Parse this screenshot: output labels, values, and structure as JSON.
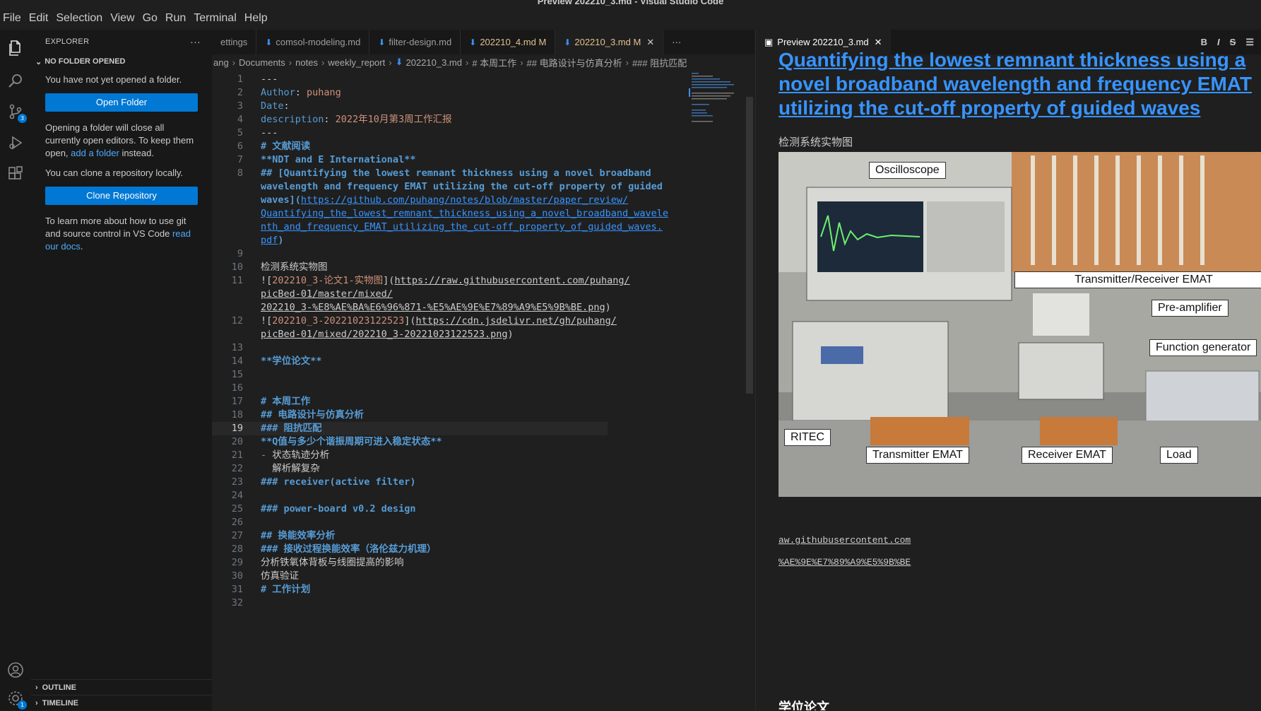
{
  "window": {
    "title": "Preview 202210_3.md - Visual Studio Code"
  },
  "menu": [
    "File",
    "Edit",
    "Selection",
    "View",
    "Go",
    "Run",
    "Terminal",
    "Help"
  ],
  "activity": {
    "scm_badge": "3",
    "settings_badge": "1"
  },
  "sidebar": {
    "title": "EXPLORER",
    "section": "NO FOLDER OPENED",
    "p1": "You have not yet opened a folder.",
    "open_folder": "Open Folder",
    "p2a": "Opening a folder will close all currently open editors. To keep them open, ",
    "p2link": "add a folder",
    "p2b": " instead.",
    "p3": "You can clone a repository locally.",
    "clone": "Clone Repository",
    "p4a": "To learn more about how to use git and source control in VS Code ",
    "p4link": "read our docs",
    "p4b": ".",
    "outline": "OUTLINE",
    "timeline": "TIMELINE"
  },
  "tabs": [
    {
      "label": "ettings",
      "state": "plain"
    },
    {
      "label": "comsol-modeling.md",
      "state": "plain"
    },
    {
      "label": "filter-design.md",
      "state": "plain"
    },
    {
      "label": "202210_4.md",
      "flag": "M",
      "state": "mod"
    },
    {
      "label": "202210_3.md",
      "flag": "M",
      "state": "active"
    }
  ],
  "breadcrumb": [
    "ang",
    "Documents",
    "notes",
    "weekly_report",
    "202210_3.md",
    "# 本周工作",
    "## 电路设计与仿真分析",
    "### 阻抗匹配"
  ],
  "preview": {
    "tab": "Preview 202210_3.md",
    "title": "Quantifying the lowest remnant thickness using a novel broadband wavelength and frequency EMAT utilizing the cut-off property of guided waves",
    "caption": "检测系统实物图",
    "labels": {
      "osc": "Oscilloscope",
      "trx": "Transmitter/Receiver EMAT",
      "pre": "Pre-amplifier",
      "fg": "Function generator",
      "ritec": "RITEC",
      "tx": "Transmitter EMAT",
      "rx": "Receiver EMAT",
      "load": "Load"
    },
    "link1": "aw.githubusercontent.com",
    "link2": "%AE%9E%E7%89%A9%E5%9B%BE",
    "heading2": "学位论文"
  }
}
